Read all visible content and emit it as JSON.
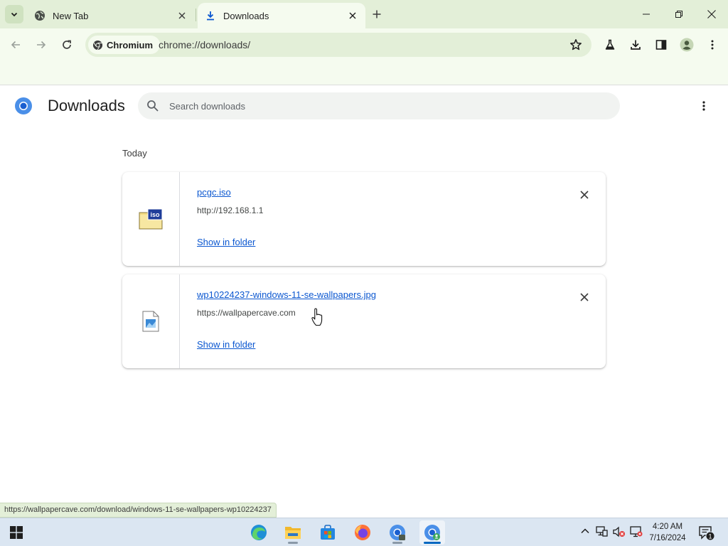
{
  "browser": {
    "tabs": [
      {
        "title": "New Tab",
        "icon": "globe-icon",
        "active": false
      },
      {
        "title": "Downloads",
        "icon": "download-icon",
        "active": true
      }
    ],
    "site_chip": "Chromium",
    "url": "chrome://downloads/"
  },
  "downloads": {
    "page_title": "Downloads",
    "search_placeholder": "Search downloads",
    "section_date": "Today",
    "items": [
      {
        "file_name": "pcgc.iso",
        "source_url": "http://192.168.1.1",
        "action_label": "Show in folder",
        "icon": "iso-file-icon"
      },
      {
        "file_name": "wp10224237-windows-11-se-wallpapers.jpg",
        "source_url": "https://wallpapercave.com",
        "action_label": "Show in folder",
        "icon": "image-file-icon"
      }
    ]
  },
  "status_bar": {
    "link_url": "https://wallpapercave.com/download/windows-11-se-wallpapers-wp10224237"
  },
  "taskbar": {
    "time": "4:20 AM",
    "date": "7/16/2024",
    "notification_count": "1",
    "apps": [
      "edge-icon",
      "file-explorer-icon",
      "microsoft-store-icon",
      "firefox-icon",
      "chromium-icon",
      "chromium-active-icon"
    ]
  },
  "colors": {
    "tabstrip": "#e3efd8",
    "toolbar": "#f5fbef",
    "link": "#0b57d0",
    "taskbar": "#dbe6f2"
  }
}
